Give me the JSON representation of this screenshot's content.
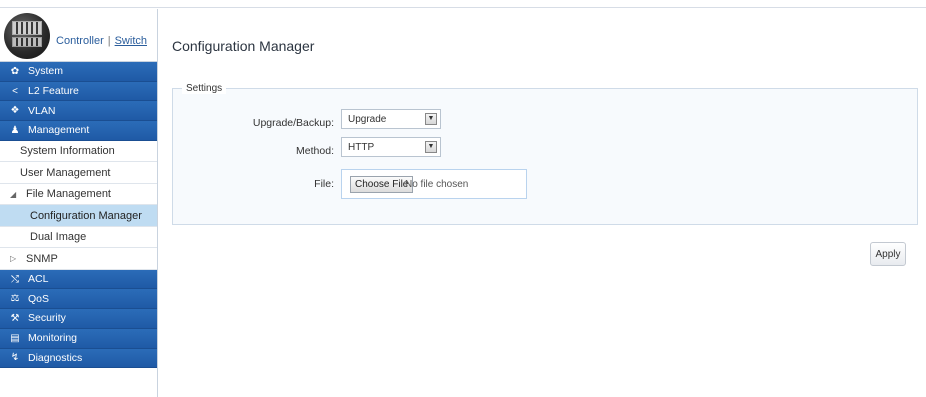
{
  "header": {
    "controller_label": "Controller",
    "separator": "|",
    "switch_label": "Switch"
  },
  "sidebar": {
    "items": [
      {
        "label": "System",
        "icon": "gear-icon"
      },
      {
        "label": "L2 Feature",
        "icon": "share-icon"
      },
      {
        "label": "VLAN",
        "icon": "network-icon"
      },
      {
        "label": "Management",
        "icon": "user-icon"
      }
    ],
    "management_sub": {
      "system_information": "System Information",
      "user_management": "User Management",
      "file_management": "File Management",
      "configuration_manager": "Configuration Manager",
      "dual_image": "Dual Image",
      "snmp": "SNMP"
    },
    "bottom_items": [
      {
        "label": "ACL",
        "icon": "shuffle-icon"
      },
      {
        "label": "QoS",
        "icon": "qos-icon"
      },
      {
        "label": "Security",
        "icon": "wrench-icon"
      },
      {
        "label": "Monitoring",
        "icon": "monitor-icon"
      },
      {
        "label": "Diagnostics",
        "icon": "diagnostics-icon"
      }
    ]
  },
  "main": {
    "title": "Configuration Manager",
    "settings_legend": "Settings",
    "upgrade_backup_label": "Upgrade/Backup:",
    "upgrade_backup_value": "Upgrade",
    "method_label": "Method:",
    "method_value": "HTTP",
    "file_label": "File:",
    "choose_file_label": "Choose File",
    "no_file_text": "No file chosen",
    "apply_label": "Apply"
  },
  "colors": {
    "nav_blue": "#1f5aa6",
    "active_bg": "#bfdcf2"
  }
}
